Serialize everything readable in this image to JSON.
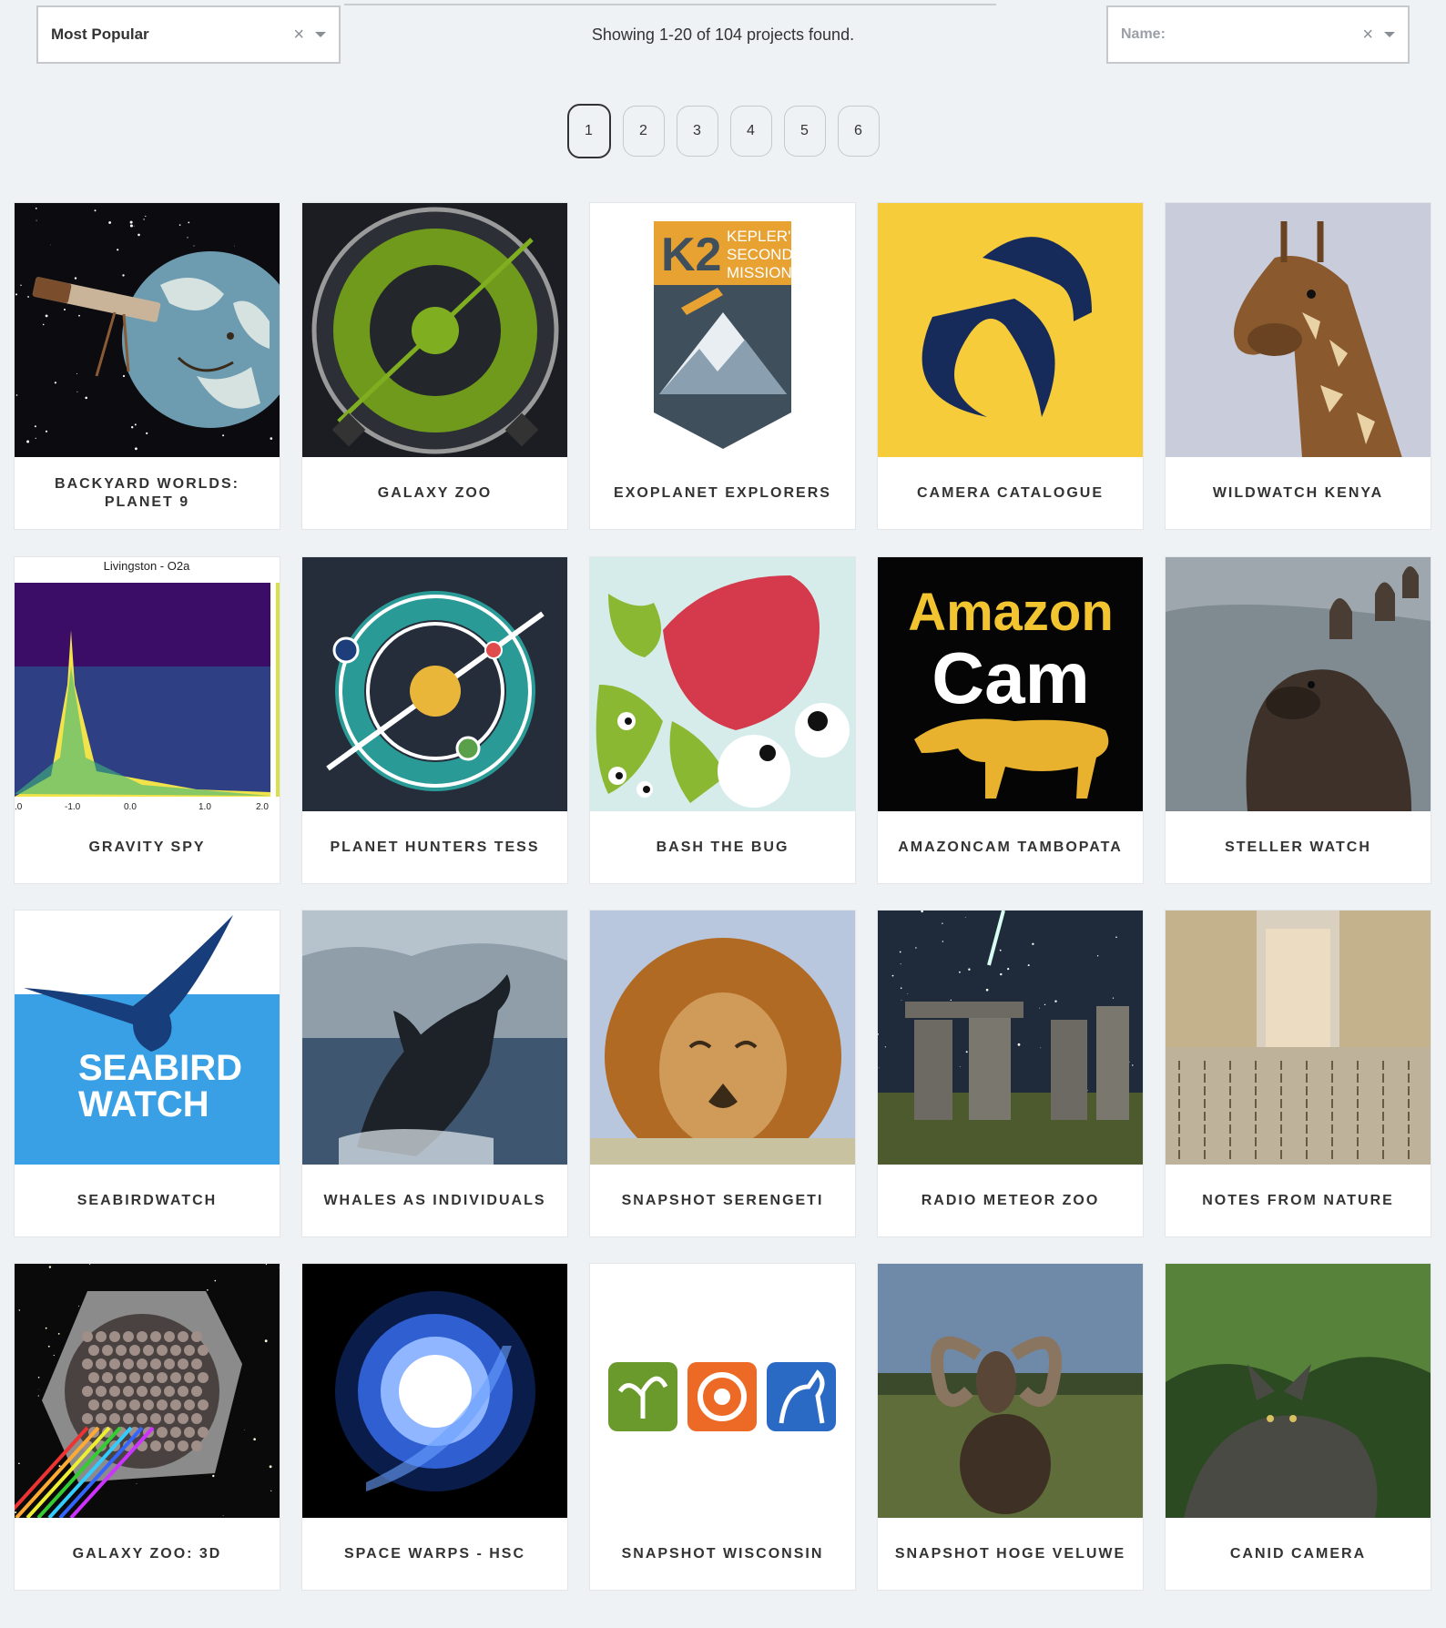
{
  "toolbar": {
    "sort_value": "Most Popular",
    "clear_glyph": "×",
    "results_text": "Showing 1-20 of 104 projects found.",
    "name_placeholder": "Name:"
  },
  "pagination": {
    "pages": [
      "1",
      "2",
      "3",
      "4",
      "5",
      "6"
    ],
    "current": "1"
  },
  "projects": [
    {
      "title": "BACKYARD WORLDS: PLANET 9",
      "image": "telescope-planet"
    },
    {
      "title": "GALAXY ZOO",
      "image": "galaxy-zoo-logo"
    },
    {
      "title": "EXOPLANET EXPLORERS",
      "image": "k2-badge",
      "badge": {
        "big": "K2",
        "l1": "KEPLER'S",
        "l2": "SECOND",
        "l3": "MISSION"
      }
    },
    {
      "title": "CAMERA CATALOGUE",
      "image": "camera-catalogue-logo"
    },
    {
      "title": "WILDWATCH KENYA",
      "image": "giraffe"
    },
    {
      "title": "GRAVITY SPY",
      "image": "spectrogram",
      "plot": {
        "title": "Livingston - O2a",
        "ticks": [
          ".0",
          "-1.0",
          "0.0",
          "1.0",
          "2.0"
        ]
      }
    },
    {
      "title": "PLANET HUNTERS TESS",
      "image": "orbit-logo"
    },
    {
      "title": "BASH THE BUG",
      "image": "bug-illustration"
    },
    {
      "title": "AMAZONCAM TAMBOPATA",
      "image": "amazon-cam-logo",
      "logo": {
        "l1": "Amazon",
        "l2": "Cam"
      }
    },
    {
      "title": "STELLER WATCH",
      "image": "sea-lions"
    },
    {
      "title": "SEABIRDWATCH",
      "image": "seabird-logo",
      "logo": {
        "l1": "SEABIRD",
        "l2": "WATCH"
      }
    },
    {
      "title": "WHALES AS INDIVIDUALS",
      "image": "breaching-whale"
    },
    {
      "title": "SNAPSHOT SERENGETI",
      "image": "lion"
    },
    {
      "title": "RADIO METEOR ZOO",
      "image": "stonehenge-meteor"
    },
    {
      "title": "NOTES FROM NATURE",
      "image": "herbarium-shelves"
    },
    {
      "title": "GALAXY ZOO: 3D",
      "image": "ifu-mosaic"
    },
    {
      "title": "SPACE WARPS - HSC",
      "image": "lensed-galaxy"
    },
    {
      "title": "SNAPSHOT WISCONSIN",
      "image": "wisconsin-icons"
    },
    {
      "title": "SNAPSHOT HOGE VELUWE",
      "image": "mouflon"
    },
    {
      "title": "CANID CAMERA",
      "image": "coyote-forest"
    }
  ]
}
